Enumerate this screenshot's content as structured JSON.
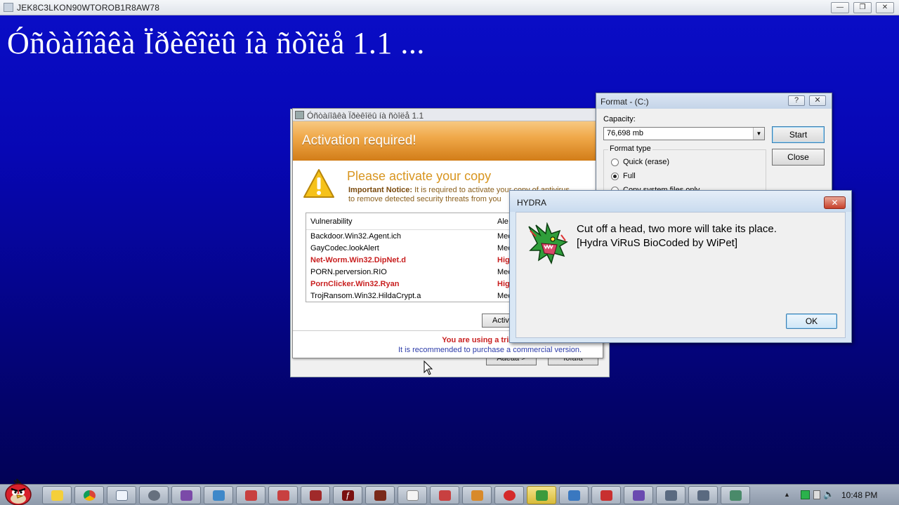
{
  "window": {
    "title": "JEK8C3LKON90WTOROB1R8AW78",
    "banner": "Óñòàíîâêà Ïðèêîëû íà ñòîëå 1.1 ..."
  },
  "av_window": {
    "title": "Óñòàíîâêà Ïðèêîëû íà ñòîëå 1.1",
    "header": "Activation required!",
    "heading": "Please activate your copy",
    "notice_bold": "Important Notice:",
    "notice_line1": "It is required to activate your copy of antivirus",
    "notice_line2": "to remove detected security threats from you",
    "table": {
      "col_vulnerability": "Vulnerability",
      "col_alert": "Ale",
      "rows": [
        {
          "name": "Backdoor.Win32.Agent.ich",
          "alert": "Mec"
        },
        {
          "name": "GayCodec.lookAlert",
          "alert": "Mec"
        },
        {
          "name": "Net-Worm.Win32.DipNet.d",
          "alert": "Hig"
        },
        {
          "name": "PORN.perversion.RIO",
          "alert": "Mec"
        },
        {
          "name": "PornClicker.Win32.Ryan",
          "alert": "Hig"
        },
        {
          "name": "TrojRansom.Win32.HildaCrypt.a",
          "alert": "Mec"
        }
      ]
    },
    "activate_button": "Activ",
    "trial_text": "You are using a trial version",
    "recommend_text": "It is recommended to purchase a commercial version.",
    "back_button": "Äàëåå >",
    "cancel_button": "Îòìåíà"
  },
  "format_dialog": {
    "title": "Format -  (C:)",
    "help": "?",
    "close_x": "✕",
    "capacity_label": "Capacity:",
    "capacity_value": "76,698 mb",
    "start_button": "Start",
    "close_button": "Close",
    "format_type_label": "Format type",
    "options": [
      "Quick (erase)",
      "Full",
      "Copy system files only"
    ],
    "selected_option": "Full"
  },
  "hydra_dialog": {
    "title": "HYDRA",
    "close_x": "✕",
    "message_line1": "Cut off a head, two more will take its place.",
    "message_line2": "[Hydra ViRuS BioCoded by WiPet]",
    "ok_button": "OK"
  },
  "taskbar": {
    "clock": "10:48 PM",
    "buttons": [
      "explorer",
      "chrome",
      "notepad",
      "settings",
      "app",
      "app",
      "app",
      "app",
      "app",
      "app",
      "flash",
      "app",
      "app",
      "app",
      "app",
      "app",
      "app",
      "app",
      "app",
      "app",
      "app",
      "app",
      "app"
    ]
  },
  "colors": {
    "desktop": "#0707b4",
    "alert_red": "#c81f1f",
    "header_orange": "#f0a94a"
  }
}
